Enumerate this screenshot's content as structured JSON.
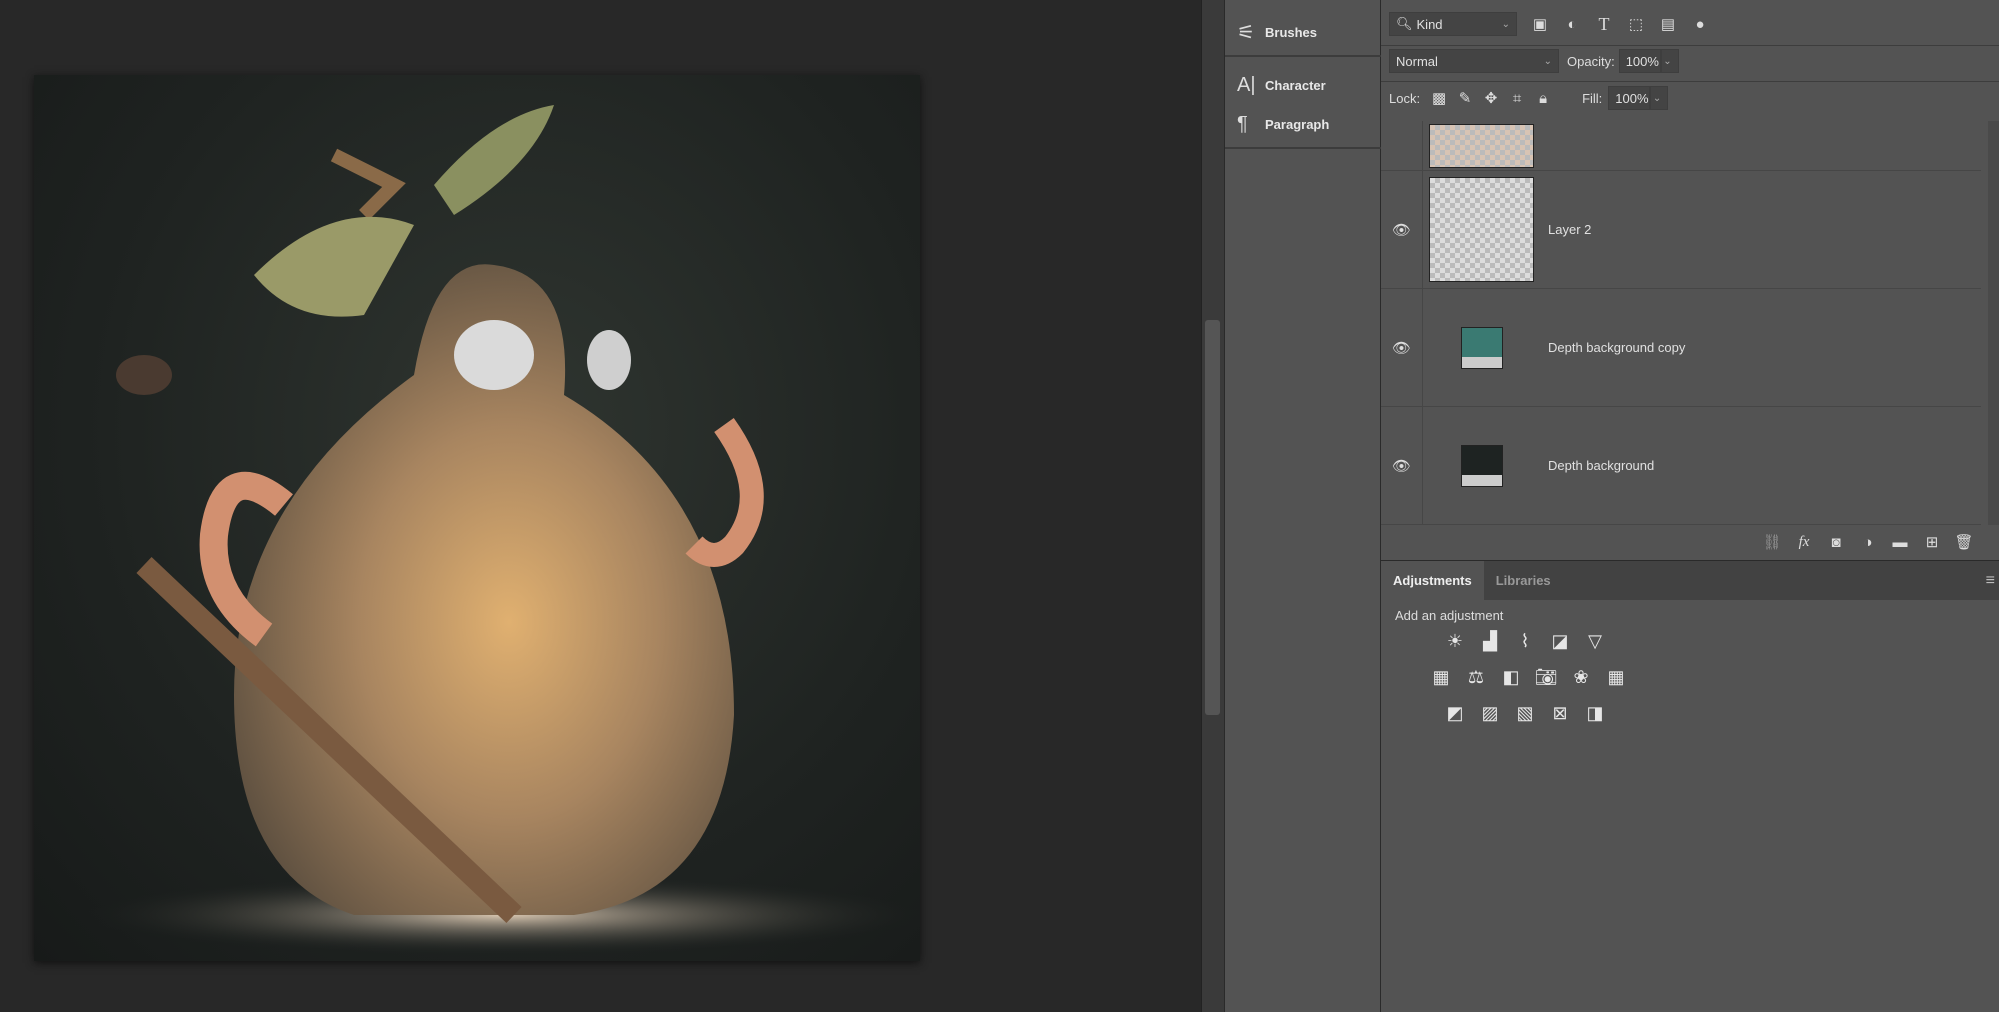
{
  "side_panel": {
    "items": [
      {
        "label": "Brushes",
        "icon": "brushes-icon"
      },
      {
        "label": "Character",
        "icon": "character-icon"
      },
      {
        "label": "Paragraph",
        "icon": "paragraph-icon"
      }
    ]
  },
  "layers": {
    "filter_kind": "Kind",
    "blend_mode": "Normal",
    "opacity_label": "Opacity:",
    "opacity": "100%",
    "lock_label": "Lock:",
    "fill_label": "Fill:",
    "fill": "100%",
    "items": [
      {
        "name": "",
        "visible": false
      },
      {
        "name": "Layer 2",
        "visible": true
      },
      {
        "name": "Depth background copy",
        "visible": true,
        "color": "#3a7a72"
      },
      {
        "name": "Depth background",
        "visible": true,
        "color": "#1e2322"
      }
    ]
  },
  "adjustments": {
    "tabs": [
      "Adjustments",
      "Libraries"
    ],
    "active_tab": "Adjustments",
    "prompt": "Add an adjustment"
  }
}
